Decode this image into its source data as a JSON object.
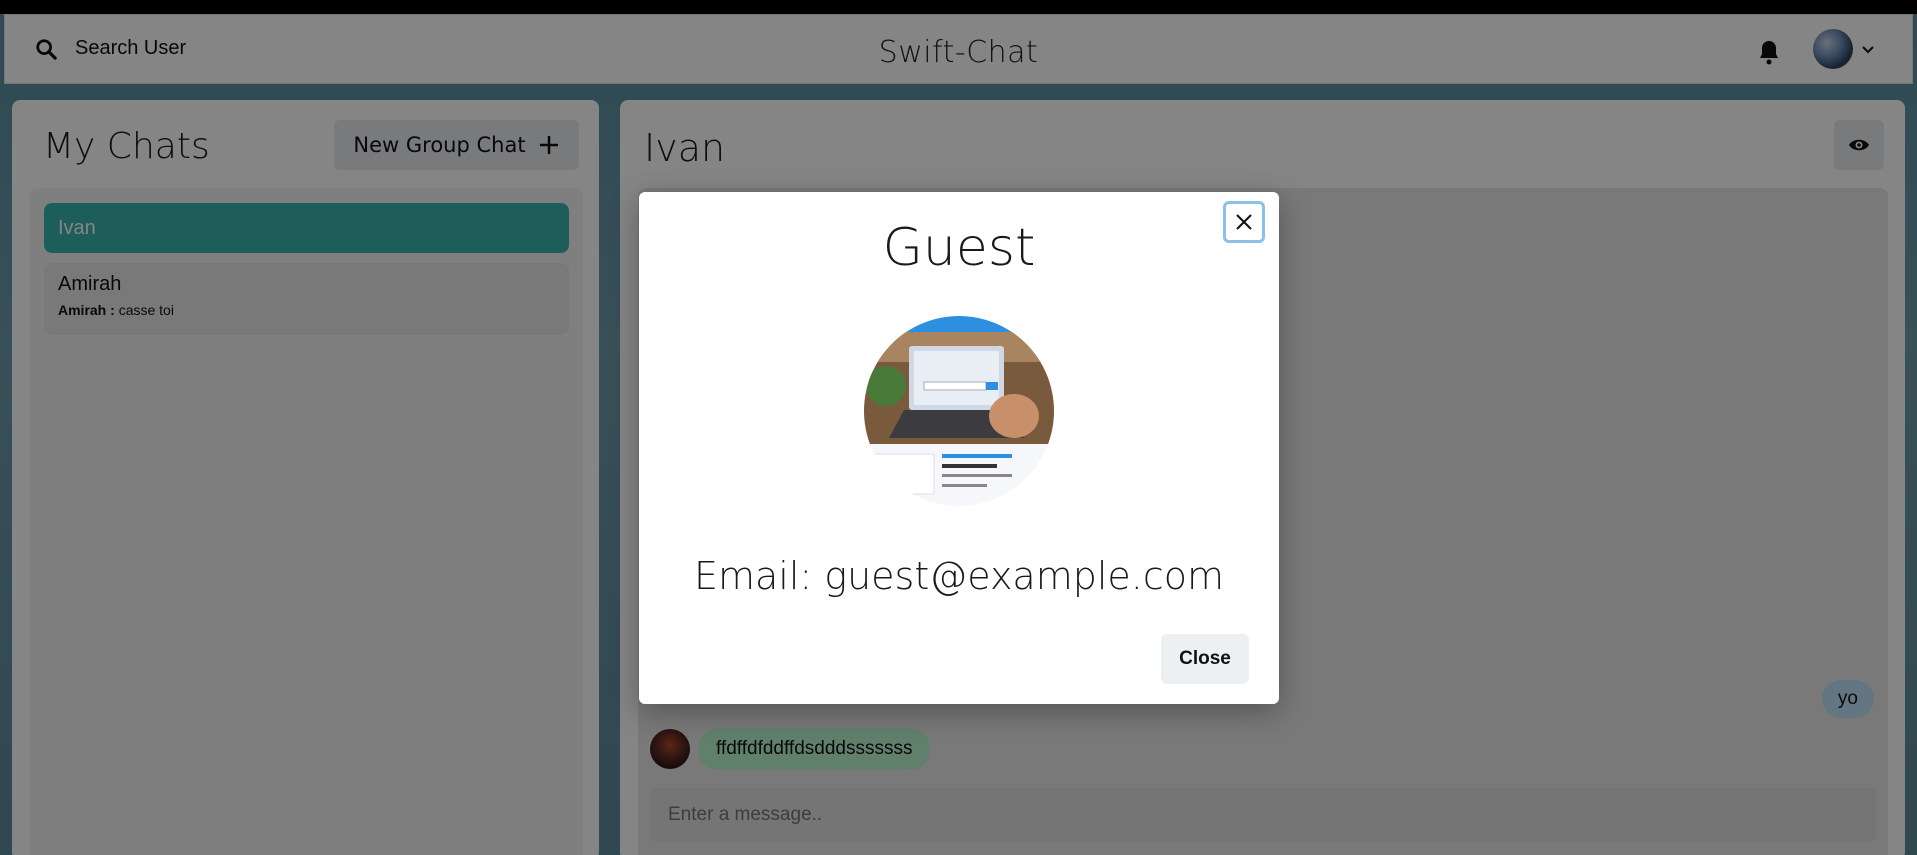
{
  "header": {
    "search_label": "Search User",
    "app_title": "Swift-Chat"
  },
  "sidebar": {
    "title": "My Chats",
    "new_group_label": "New Group Chat",
    "chats": [
      {
        "name": "Ivan",
        "active": true
      },
      {
        "name": "Amirah",
        "latest_sender": "Amirah :",
        "latest_text": "casse toi",
        "active": false
      }
    ]
  },
  "chat": {
    "title": "Ivan",
    "messages": [
      {
        "text": "yo",
        "mine": true
      },
      {
        "text": "ffdffdfddffdsdddsssssss",
        "mine": false
      }
    ],
    "input_placeholder": "Enter a message.."
  },
  "modal": {
    "title": "Guest",
    "email_line": "Email: guest@example.com",
    "close_label": "Close"
  },
  "colors": {
    "active_chat": "#38b2ac",
    "my_bubble": "#bee3f8",
    "their_bubble": "#b9f5d0",
    "close_focus_ring": "#8cc0e8"
  }
}
